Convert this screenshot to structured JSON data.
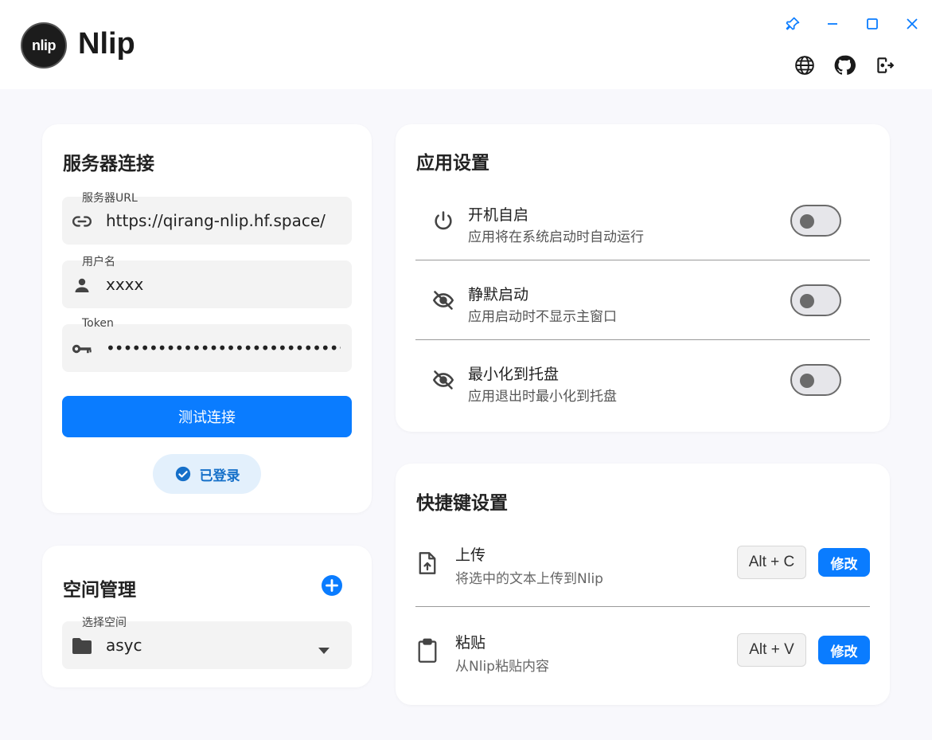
{
  "app": {
    "logo_text": "nlip",
    "title": "Nlip"
  },
  "window_controls": [
    "pin-icon",
    "minimize-icon",
    "maximize-icon",
    "close-icon"
  ],
  "toolbar": [
    "globe-icon",
    "github-icon",
    "logout-icon"
  ],
  "server": {
    "title": "服务器连接",
    "url_label": "服务器URL",
    "url_value": "https://qirang-nlip.hf.space/",
    "username_label": "用户名",
    "username_value": "xxxx",
    "token_label": "Token",
    "token_value": "••••••••••••••••••••••••••••••••",
    "test_button": "测试连接",
    "status": "已登录"
  },
  "space": {
    "title": "空间管理",
    "select_label": "选择空间",
    "select_value": "asyc"
  },
  "app_settings": {
    "title": "应用设置",
    "items": [
      {
        "title": "开机自启",
        "desc": "应用将在系统启动时自动运行",
        "icon": "power-icon",
        "enabled": false
      },
      {
        "title": "静默启动",
        "desc": "应用启动时不显示主窗口",
        "icon": "eye-off-icon",
        "enabled": false
      },
      {
        "title": "最小化到托盘",
        "desc": "应用退出时最小化到托盘",
        "icon": "eye-off-icon",
        "enabled": false
      }
    ]
  },
  "hotkeys": {
    "title": "快捷键设置",
    "items": [
      {
        "title": "上传",
        "desc": "将选中的文本上传到Nlip",
        "key": "Alt + C",
        "button": "修改",
        "icon": "file-upload-icon"
      },
      {
        "title": "粘贴",
        "desc": "从Nlip粘贴内容",
        "key": "Alt + V",
        "button": "修改",
        "icon": "clipboard-icon"
      }
    ]
  },
  "colors": {
    "accent": "#0a7cff",
    "background": "#f8f8fc",
    "card": "#ffffff",
    "field": "#f3f3f3"
  }
}
